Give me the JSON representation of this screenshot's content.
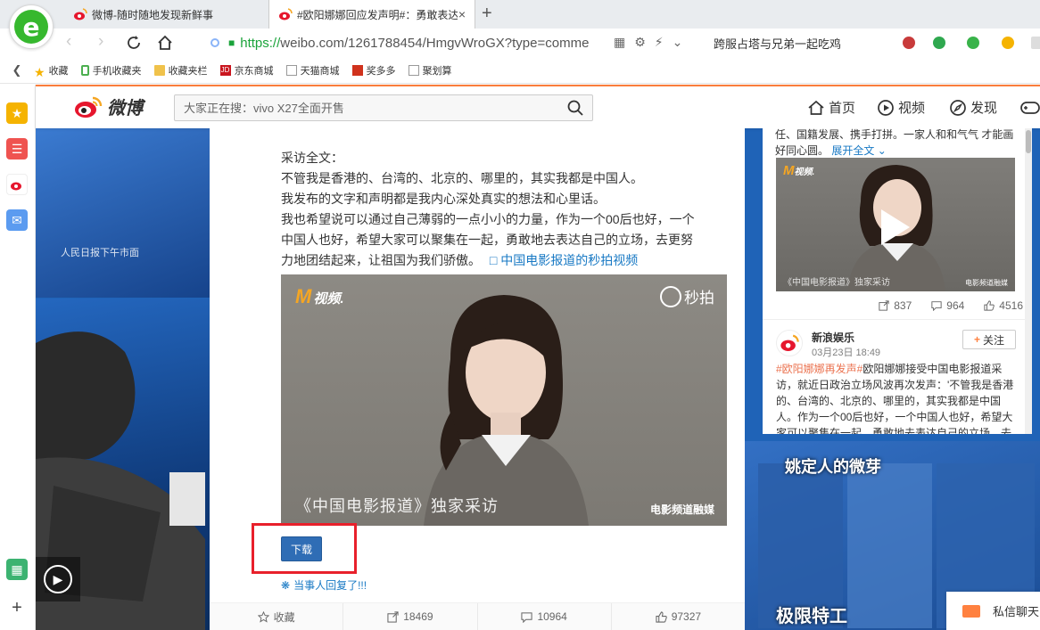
{
  "browser": {
    "tabs": [
      {
        "label": "微博-随时随地发现新鲜事"
      },
      {
        "label": "#欧阳娜娜回应发声明#：勇敢表达"
      }
    ],
    "close_glyph": "×",
    "new_tab_glyph": "+",
    "address": {
      "protocol": "https://",
      "url_rest": "weibo.com/1261788454/HmgvWroGX?type=comme"
    },
    "hot_search": "跨服占塔与兄弟一起吃鸡",
    "bookmarks": [
      "收藏",
      "手机收藏夹",
      "收藏夹栏",
      "京东商城",
      "天猫商城",
      "奖多多",
      "聚划算"
    ],
    "bookmark_icon_colors": [
      "#f5b301",
      "#4caf50",
      "#f0c24b",
      "#c9151e",
      "#999999",
      "#d0321d",
      "#999999"
    ]
  },
  "weibo": {
    "logo_text": "微博",
    "search_placeholder": "大家正在搜：vivo X27全面开售",
    "nav": [
      "首页",
      "视频",
      "发现"
    ],
    "accent_color": "#fa7d3c"
  },
  "post": {
    "lines": [
      "采访全文：",
      "不管我是香港的、台湾的、北京的、哪里的，其实我都是中国人。",
      "我发布的文字和声明都是我内心深处真实的想法和心里话。",
      "我也希望说可以通过自己薄弱的一点小小的力量，作为一个00后也好，一个中国人也好，希望大家可以聚集在一起，勇敢地去表达自己的立场，去更努力地团结起来，让祖国为我们骄傲。"
    ],
    "video_link": "中国电影报道的秒拍视频",
    "video": {
      "logo": "视频.",
      "logo_mark": "M",
      "platform": "秒拍",
      "caption": "《中国电影报道》独家采访",
      "brand": "电影频道融媒"
    },
    "download_label": "下载",
    "reply_note": "当事人回复了!!!",
    "actions": {
      "favorite": "收藏",
      "repost": "18469",
      "comment": "10964",
      "like": "97327"
    }
  },
  "right_column": {
    "top_text": "任、国籍发展、携手打拼。一家人和和气气 才能画好同心圆。",
    "expand_label": "展开全文",
    "video": {
      "logo": "视频.",
      "logo_mark": "M",
      "caption": "《中国电影报道》独家采访",
      "brand": "电影频道融媒"
    },
    "stats": {
      "repost": "837",
      "comment": "964",
      "like": "4516"
    },
    "account": {
      "name": "新浪娱乐",
      "time": "03月23日 18:49",
      "follow_label": "关注"
    },
    "post_hashtag": "#欧阳娜娜再发声#",
    "post_text": "欧阳娜娜接受中国电影报道采访，就近日政治立场风波再次发声：'不管我是香港的、台湾的、北京的、哪里的，其实我都是中国人。作为一个00后也好，一个中国人也好，希望大家可以聚集在一起，勇敢地去表达自己的立场，去"
  },
  "background": {
    "poster_left_text": "人民日报下午市面",
    "poster_right_title_1": "姚定人的微芽",
    "poster_right_title_2": "极限特工"
  },
  "private_message": "私信聊天"
}
